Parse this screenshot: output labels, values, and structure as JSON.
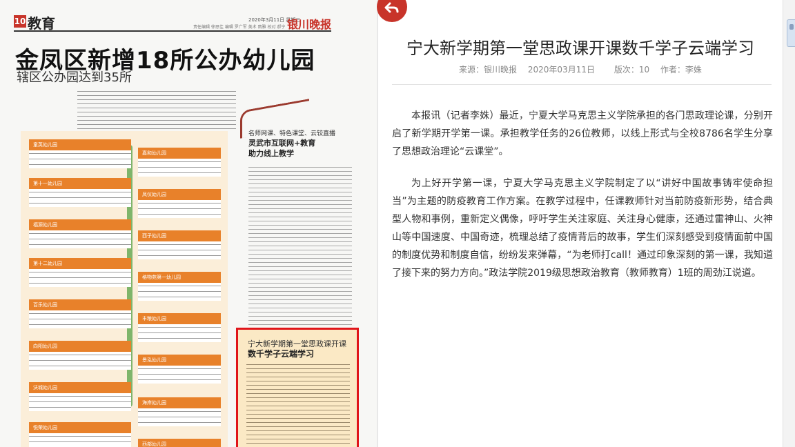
{
  "newspaper": {
    "page_number": "10",
    "section": "教育",
    "date": "2020年3月11日 星期三",
    "editor": "责任编辑 徐思佳 编辑 罗广军 美术 隋雅 校对 郝宁",
    "brand": "银川晚报",
    "headline": "金凤区新增18所公办幼儿园",
    "subhead": "辖区公办园达到35所",
    "side_kicker": "名师网课、特色课堂、云较直播",
    "side_title_line1": "灵武市互联网+教育",
    "side_title_line2": "助力线上教学",
    "highlight_line1": "宁大新学期第一堂思政课开课",
    "highlight_line2": "数千学子云端学习",
    "cards_left": [
      "童英幼儿园",
      "第十一幼儿园",
      "福源幼儿园",
      "第十二幼儿园",
      "百乐幼儿园",
      "向阳幼儿园",
      "沃城幼儿园",
      "悦荣幼儿园"
    ],
    "cards_right": [
      "嘉和幼儿园",
      "凤仪幼儿园",
      "西子幼儿园",
      "格物苑第一幼儿园",
      "丰粮幼儿园",
      "景泓幼儿园",
      "海岸幼儿园",
      "西部幼儿园"
    ]
  },
  "article": {
    "title": "宁大新学期第一堂思政课开课数千学子云端学习",
    "meta": {
      "source": "来源：银川晚报",
      "date": "2020年03月11日",
      "edition": "版次：10",
      "author": "作者：李姝"
    },
    "paragraphs": [
      "本报讯（记者李姝）最近，宁夏大学马克思主义学院承担的各门思政理论课，分别开启了新学期开学第一课。承担教学任务的26位教师，以线上形式与全校8786名学生分享了思想政治理论“云课堂”。",
      "为上好开学第一课，宁夏大学马克思主义学院制定了以“讲好中国故事铸牢使命担当”为主题的防疫教育工作方案。在教学过程中，任课教师针对当前防疫新形势，结合典型人物和事例，重新定义偶像，呼吁学生关注家庭、关注身心健康，还通过雷神山、火神山等中国速度、中国奇迹，梳理总结了疫情背后的故事，学生们深刻感受到疫情面前中国的制度优势和制度自信，纷纷发来弹幕，“为老师打call！通过印象深刻的第一课，我知道了接下来的努力方向。”政法学院2019级思想政治教育（教师教育）1班的周劲江说道。"
    ]
  },
  "colors": {
    "accent": "#c8342a",
    "highlight_border": "#e0151a",
    "card_orange": "#e8812a"
  },
  "icons": {
    "back": "back-arrow-icon",
    "side_tab": "side-tab-icon"
  }
}
